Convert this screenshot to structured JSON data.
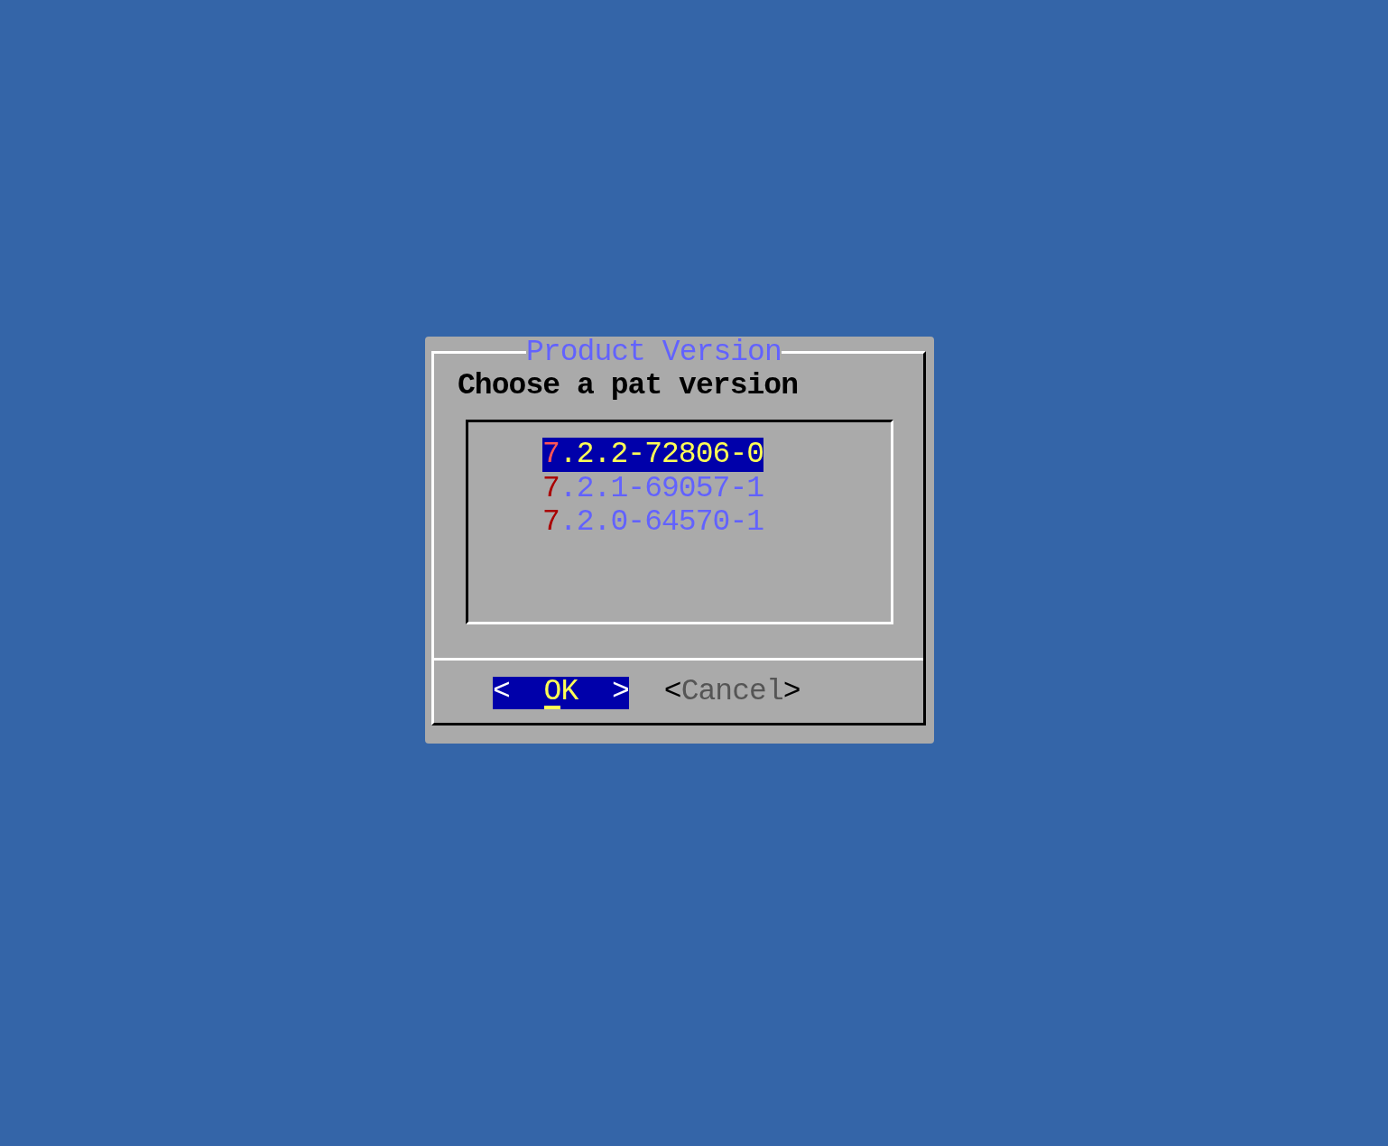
{
  "dialog": {
    "title": "Product Version",
    "prompt": "Choose a pat version",
    "items": [
      {
        "label": "7.2.2-72806-0",
        "selected": true
      },
      {
        "label": "7.2.1-69057-1",
        "selected": false
      },
      {
        "label": "7.2.0-64570-1",
        "selected": false
      }
    ],
    "buttons": [
      {
        "bracket_left": "<",
        "label": "OK",
        "bracket_right": ">",
        "selected": true
      },
      {
        "bracket_left": "<",
        "label": "Cancel",
        "bracket_right": ">",
        "selected": false
      }
    ]
  }
}
